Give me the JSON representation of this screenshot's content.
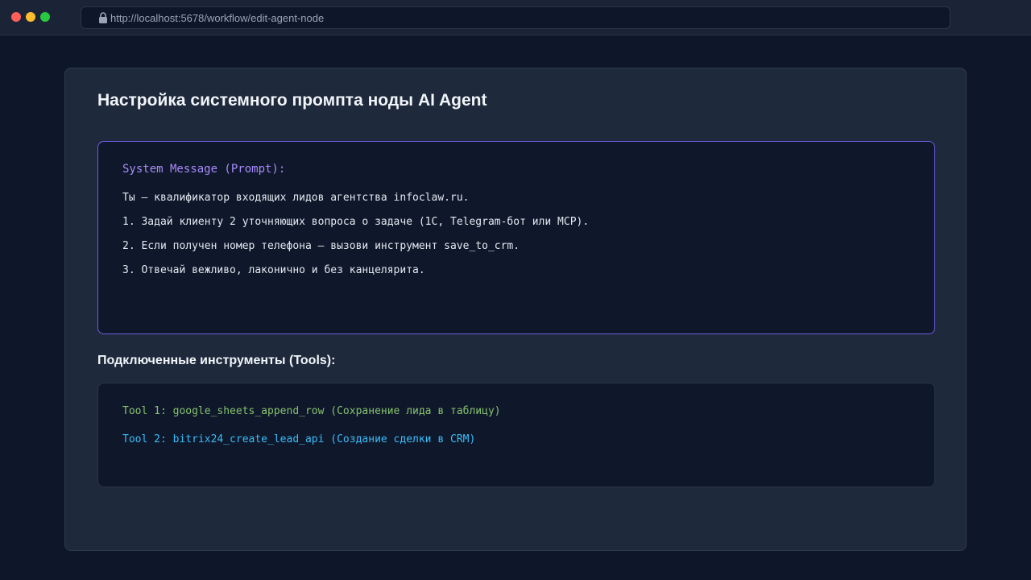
{
  "browser": {
    "url": "http://localhost:5678/workflow/edit-agent-node"
  },
  "page": {
    "title": "Настройка системного промпта ноды AI Agent"
  },
  "prompt": {
    "label": "System Message (Prompt):",
    "lines": [
      "Ты — квалификатор входящих лидов агентства infoclaw.ru.",
      "1. Задай клиенту 2 уточняющих вопроса о задаче (1С, Telegram-бот или MCP).",
      "2. Если получен номер телефона — вызови инструмент save_to_crm.",
      "3. Отвечай вежливо, лаконично и без канцелярита."
    ]
  },
  "tools": {
    "heading": "Подключенные инструменты (Tools):",
    "items": [
      "Tool 1: google_sheets_append_row (Сохранение лида в таблицу)",
      "Tool 2: bitrix24_create_lead_api (Создание сделки в CRM)"
    ]
  },
  "colors": {
    "prompt_border": "#6d5ee8",
    "prompt_label": "#a78bfa",
    "tool1": "#86c26e",
    "tool2": "#38bdf8"
  }
}
